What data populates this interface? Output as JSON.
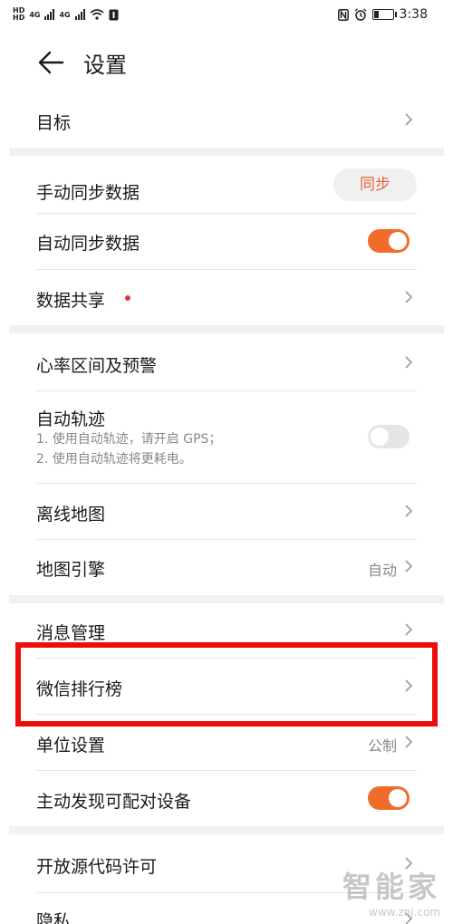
{
  "status_bar": {
    "hd1": "HD",
    "hd2": "HD",
    "net1": "4G",
    "net2": "4G",
    "time": "3:38"
  },
  "header": {
    "title": "设置"
  },
  "rows": {
    "target": {
      "label": "目标"
    },
    "manual_sync": {
      "label": "手动同步数据",
      "button": "同步"
    },
    "auto_sync": {
      "label": "自动同步数据",
      "enabled": true
    },
    "data_share": {
      "label": "数据共享"
    },
    "heart_rate": {
      "label": "心率区间及预警"
    },
    "auto_track": {
      "label": "自动轨迹",
      "note1": "1. 使用自动轨迹，请开启 GPS；",
      "note2": "2. 使用自动轨迹将更耗电。",
      "enabled": false
    },
    "offline_map": {
      "label": "离线地图"
    },
    "map_engine": {
      "label": "地图引擎",
      "value": "自动"
    },
    "message_mgmt": {
      "label": "消息管理"
    },
    "wechat_rank": {
      "label": "微信排行榜"
    },
    "unit_settings": {
      "label": "单位设置",
      "value": "公制"
    },
    "discover_devices": {
      "label": "主动发现可配对设备",
      "enabled": true
    },
    "open_source": {
      "label": "开放源代码许可"
    },
    "privacy": {
      "label": "隐私"
    }
  },
  "colors": {
    "accent": "#f06c2a",
    "highlight": "#ee0d0d",
    "notify_dot": "#e23636"
  },
  "watermark": {
    "text": "智能家",
    "url": "www.znj.com"
  }
}
